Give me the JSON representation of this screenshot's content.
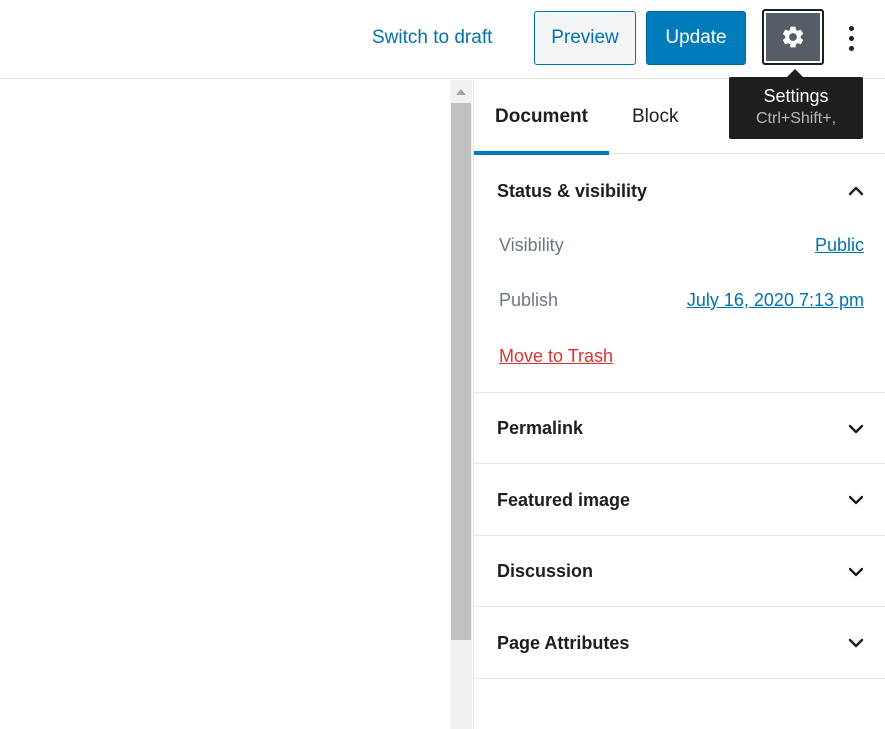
{
  "toolbar": {
    "switch_to_draft": "Switch to draft",
    "preview": "Preview",
    "update": "Update",
    "settings_icon": "gear-icon",
    "more_icon": "vertical-ellipsis-icon"
  },
  "tooltip": {
    "title": "Settings",
    "shortcut": "Ctrl+Shift+,"
  },
  "sidebar": {
    "tabs": [
      {
        "label": "Document",
        "active": true
      },
      {
        "label": "Block",
        "active": false
      }
    ],
    "status_visibility": {
      "title": "Status & visibility",
      "expanded": true,
      "visibility_label": "Visibility",
      "visibility_value": "Public",
      "publish_label": "Publish",
      "publish_value": "July 16, 2020 7:13 pm",
      "trash_label": "Move to Trash"
    },
    "panels": [
      {
        "title": "Permalink",
        "expanded": false
      },
      {
        "title": "Featured image",
        "expanded": false
      },
      {
        "title": "Discussion",
        "expanded": false
      },
      {
        "title": "Page Attributes",
        "expanded": false
      }
    ]
  },
  "colors": {
    "accent": "#007cba",
    "link": "#0073aa",
    "danger": "#dc3232",
    "tooltip_bg": "#1e1e1e"
  }
}
